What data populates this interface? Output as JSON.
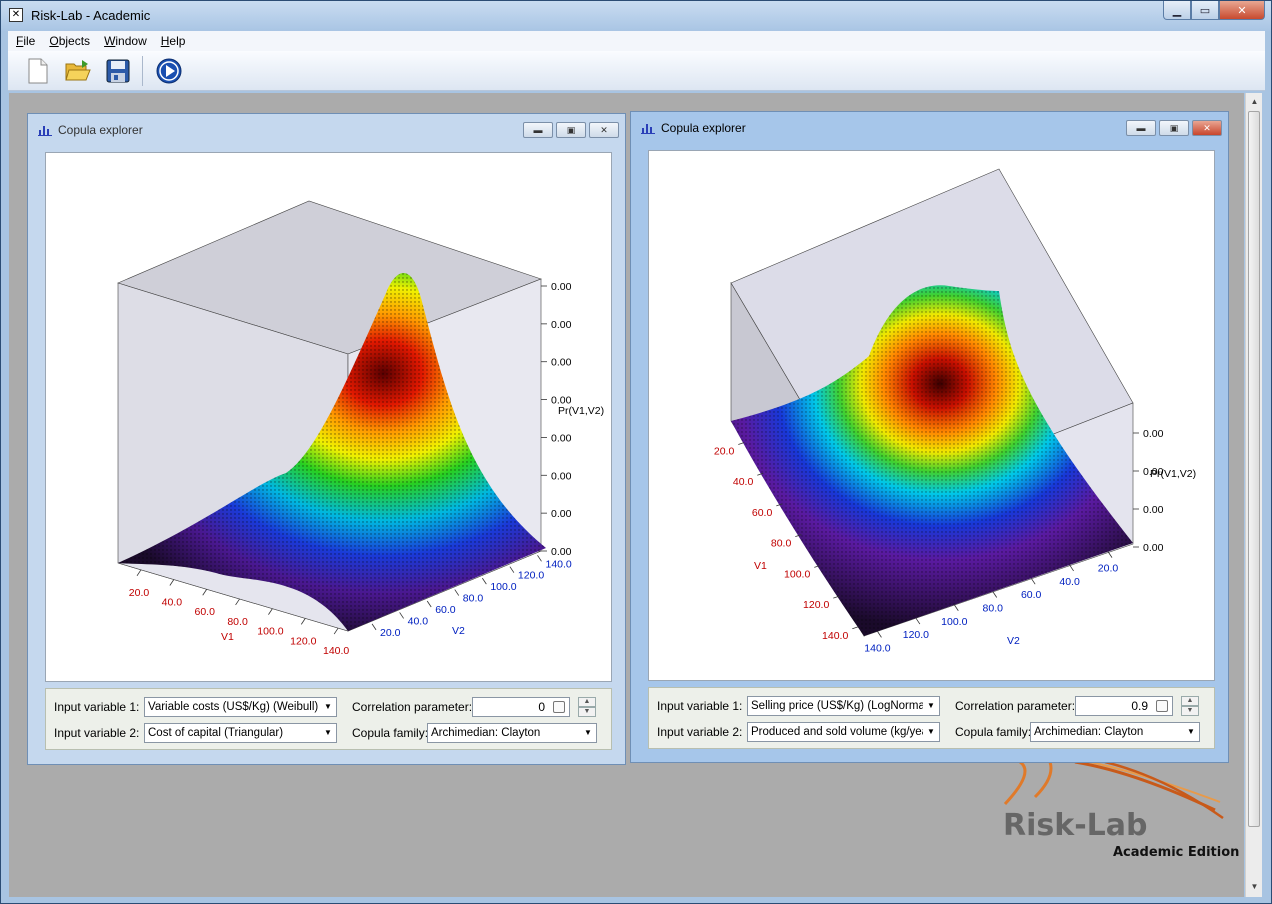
{
  "app": {
    "title": "Risk-Lab - Academic"
  },
  "menu": [
    {
      "label": "File",
      "ul": "F",
      "rest": "ile"
    },
    {
      "label": "Objects",
      "ul": "O",
      "rest": "bjects"
    },
    {
      "label": "Window",
      "ul": "W",
      "rest": "indow"
    },
    {
      "label": "Help",
      "ul": "H",
      "rest": "elp"
    }
  ],
  "toolbar": {
    "new_icon": "new-document-icon",
    "open_icon": "open-folder-icon",
    "save_icon": "save-disk-icon",
    "run_icon": "play-run-icon"
  },
  "windows": [
    {
      "title": "Copula explorer",
      "v1_label": "Input variable 1:",
      "v1_value": "Variable costs (US$/Kg) (Weibull)",
      "v2_label": "Input variable 2:",
      "v2_value": "Cost of capital (Triangular)",
      "corr_label": "Correlation parameter:",
      "corr_value": "0",
      "family_label": "Copula family:",
      "family_value": "Archimedian: Clayton"
    },
    {
      "title": "Copula explorer",
      "v1_label": "Input variable 1:",
      "v1_value": "Selling price (US$/Kg) (LogNormal)",
      "v2_label": "Input variable 2:",
      "v2_value": "Produced and sold volume (kg/year",
      "corr_label": "Correlation parameter:",
      "corr_value": "0.9",
      "family_label": "Copula family:",
      "family_value": "Archimedian: Clayton"
    }
  ],
  "chart_data": [
    {
      "type": "surface3d",
      "z_label": "Pr(V1,V2)",
      "x_label": "V1",
      "y_label": "V2",
      "x_ticks": [
        "20.0",
        "40.0",
        "60.0",
        "80.0",
        "100.0",
        "120.0",
        "140.0"
      ],
      "y_ticks": [
        "20.0",
        "40.0",
        "60.0",
        "80.0",
        "100.0",
        "120.0",
        "140.0"
      ],
      "z_ticks": [
        "0.00",
        "0.00",
        "0.00",
        "0.00",
        "0.00",
        "0.00",
        "0.00",
        "0.00"
      ]
    },
    {
      "type": "surface3d",
      "z_label": "Pr(V1,V2)",
      "x_label": "V1",
      "y_label": "V2",
      "x_ticks": [
        "20.0",
        "40.0",
        "60.0",
        "80.0",
        "100.0",
        "120.0",
        "140.0"
      ],
      "y_ticks": [
        "20.0",
        "40.0",
        "60.0",
        "80.0",
        "100.0",
        "120.0",
        "140.0"
      ],
      "z_ticks": [
        "0.00",
        "0.00",
        "0.00",
        "0.00"
      ]
    }
  ],
  "logo": {
    "name": "Risk-Lab",
    "edition": "Academic Edition"
  },
  "colors": {
    "accent": "#1a4fb0",
    "logo_orange": "#e07a2a"
  }
}
